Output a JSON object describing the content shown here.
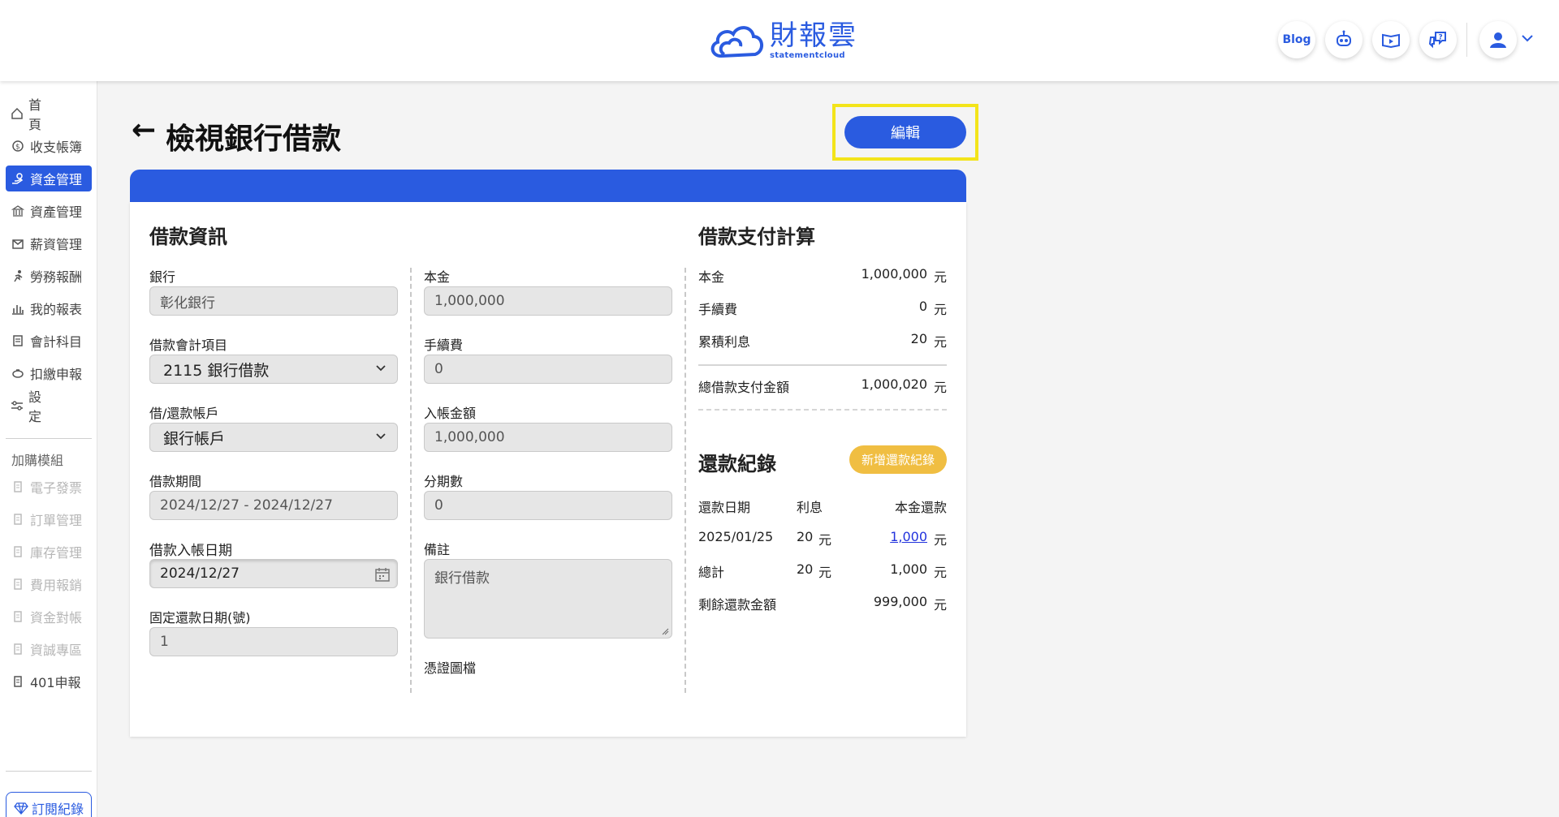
{
  "header": {
    "logo_main": "財報雲",
    "logo_sub": "statementcloud",
    "blog_label": "Blog",
    "icons": [
      "robot-icon",
      "video-book-icon",
      "help-chat-icon",
      "user-avatar-icon",
      "chevron-down-icon"
    ]
  },
  "sidebar": {
    "items": [
      {
        "label": "首頁",
        "icon": "home-icon"
      },
      {
        "label": "收支帳簿",
        "icon": "coin-icon"
      },
      {
        "label": "資金管理",
        "icon": "hand-coin-icon"
      },
      {
        "label": "資產管理",
        "icon": "bank-icon"
      },
      {
        "label": "薪資管理",
        "icon": "envelope-icon"
      },
      {
        "label": "勞務報酬",
        "icon": "runner-icon"
      },
      {
        "label": "我的報表",
        "icon": "bar-chart-icon"
      },
      {
        "label": "會計科目",
        "icon": "ledger-icon"
      },
      {
        "label": "扣繳申報",
        "icon": "piggy-icon"
      },
      {
        "label": "設定",
        "icon": "sliders-icon"
      }
    ],
    "addon_label": "加購模組",
    "addons": [
      "電子發票",
      "訂單管理",
      "庫存管理",
      "費用報銷",
      "資金對帳",
      "資誠專區",
      "401申報"
    ],
    "subscription_label": "訂閱紀錄"
  },
  "page": {
    "back_arrow": "←",
    "title": "檢視銀行借款",
    "edit_label": "編輯"
  },
  "loan_info": {
    "title": "借款資訊",
    "bank_label": "銀行",
    "bank_value": "彰化銀行",
    "account_label": "借款會計項目",
    "account_value": "2115 銀行借款",
    "repay_account_label": "借/還款帳戶",
    "repay_account_value": "銀行帳戶",
    "period_label": "借款期間",
    "period_value": "2024/12/27 - 2024/12/27",
    "entry_date_label": "借款入帳日期",
    "entry_date_value": "2024/12/27",
    "fixed_day_label": "固定還款日期(號)",
    "fixed_day_value": "1",
    "principal_label": "本金",
    "principal_value": "1,000,000",
    "fee_label": "手續費",
    "fee_value": "0",
    "deposit_label": "入帳金額",
    "deposit_value": "1,000,000",
    "installments_label": "分期數",
    "installments_value": "0",
    "note_label": "備註",
    "note_value": "銀行借款",
    "attachment_label": "憑證圖檔"
  },
  "payment_calc": {
    "title": "借款支付計算",
    "unit": "元",
    "rows": [
      {
        "label": "本金",
        "value": "1,000,000"
      },
      {
        "label": "手續費",
        "value": "0"
      },
      {
        "label": "累積利息",
        "value": "20"
      }
    ],
    "total_label": "總借款支付金額",
    "total_value": "1,000,020"
  },
  "repayment": {
    "title": "還款紀錄",
    "add_label": "新增還款紀錄",
    "headers": [
      "還款日期",
      "利息",
      "本金還款"
    ],
    "row": {
      "date": "2025/01/25",
      "interest": "20",
      "principal": "1,000"
    },
    "total_label": "總計",
    "total_interest": "20",
    "total_principal": "1,000",
    "remaining_label": "剩餘還款金額",
    "remaining_value": "999,000",
    "unit": "元"
  },
  "colors": {
    "primary": "#2a5be0",
    "accent": "#f0be42",
    "highlight": "#f3e41a"
  }
}
